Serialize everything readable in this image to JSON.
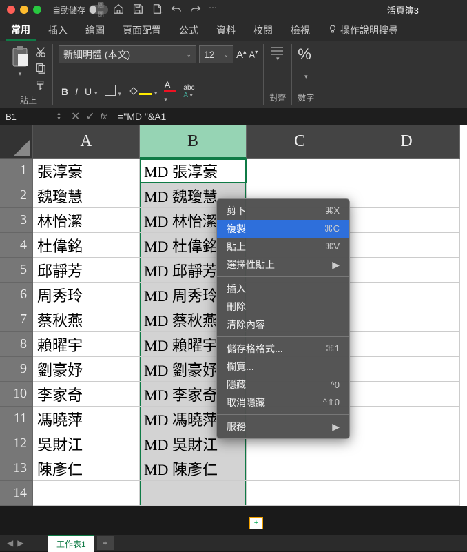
{
  "window": {
    "autosave": "自動儲存",
    "autosave_state": "關閉",
    "title": "活頁簿3"
  },
  "tabs": [
    "常用",
    "插入",
    "繪圖",
    "頁面配置",
    "公式",
    "資料",
    "校閱",
    "檢視"
  ],
  "tab_help": "操作說明搜尋",
  "ribbon": {
    "paste": "貼上",
    "font_name": "新細明體 (本文)",
    "font_size": "12",
    "align_label": "對齊",
    "number_label": "數字",
    "bold": "B",
    "italic": "I",
    "underline": "U",
    "ruby": "abc"
  },
  "formula_bar": {
    "name_box": "B1",
    "formula": "=\"MD \"&A1"
  },
  "columns": [
    "A",
    "B",
    "C",
    "D"
  ],
  "rows": [
    {
      "n": "1",
      "a": "張淳豪",
      "b": "MD 張淳豪"
    },
    {
      "n": "2",
      "a": "魏瓊慧",
      "b": "MD 魏瓊慧"
    },
    {
      "n": "3",
      "a": "林怡潔",
      "b": "MD 林怡潔"
    },
    {
      "n": "4",
      "a": "杜偉銘",
      "b": "MD 杜偉銘"
    },
    {
      "n": "5",
      "a": "邱靜芳",
      "b": "MD 邱靜芳"
    },
    {
      "n": "6",
      "a": "周秀玲",
      "b": "MD 周秀玲"
    },
    {
      "n": "7",
      "a": "蔡秋燕",
      "b": "MD 蔡秋燕"
    },
    {
      "n": "8",
      "a": "賴曜宇",
      "b": "MD 賴曜宇"
    },
    {
      "n": "9",
      "a": "劉豪妤",
      "b": "MD 劉豪妤"
    },
    {
      "n": "10",
      "a": "李家奇",
      "b": "MD 李家奇"
    },
    {
      "n": "11",
      "a": "馮曉萍",
      "b": "MD 馮曉萍"
    },
    {
      "n": "12",
      "a": "吳財江",
      "b": "MD 吳財江"
    },
    {
      "n": "13",
      "a": "陳彥仁",
      "b": "MD 陳彥仁"
    },
    {
      "n": "14",
      "a": "",
      "b": ""
    }
  ],
  "context_menu": {
    "cut": "剪下",
    "cut_k": "⌘X",
    "copy": "複製",
    "copy_k": "⌘C",
    "paste": "貼上",
    "paste_k": "⌘V",
    "paste_special": "選擇性貼上",
    "insert": "插入",
    "delete": "刪除",
    "clear": "清除內容",
    "format": "儲存格格式...",
    "format_k": "⌘1",
    "colwidth": "欄寬...",
    "hide": "隱藏",
    "hide_k": "^0",
    "unhide": "取消隱藏",
    "unhide_k": "^⇧0",
    "services": "服務"
  },
  "sheet": {
    "name": "工作表1"
  }
}
